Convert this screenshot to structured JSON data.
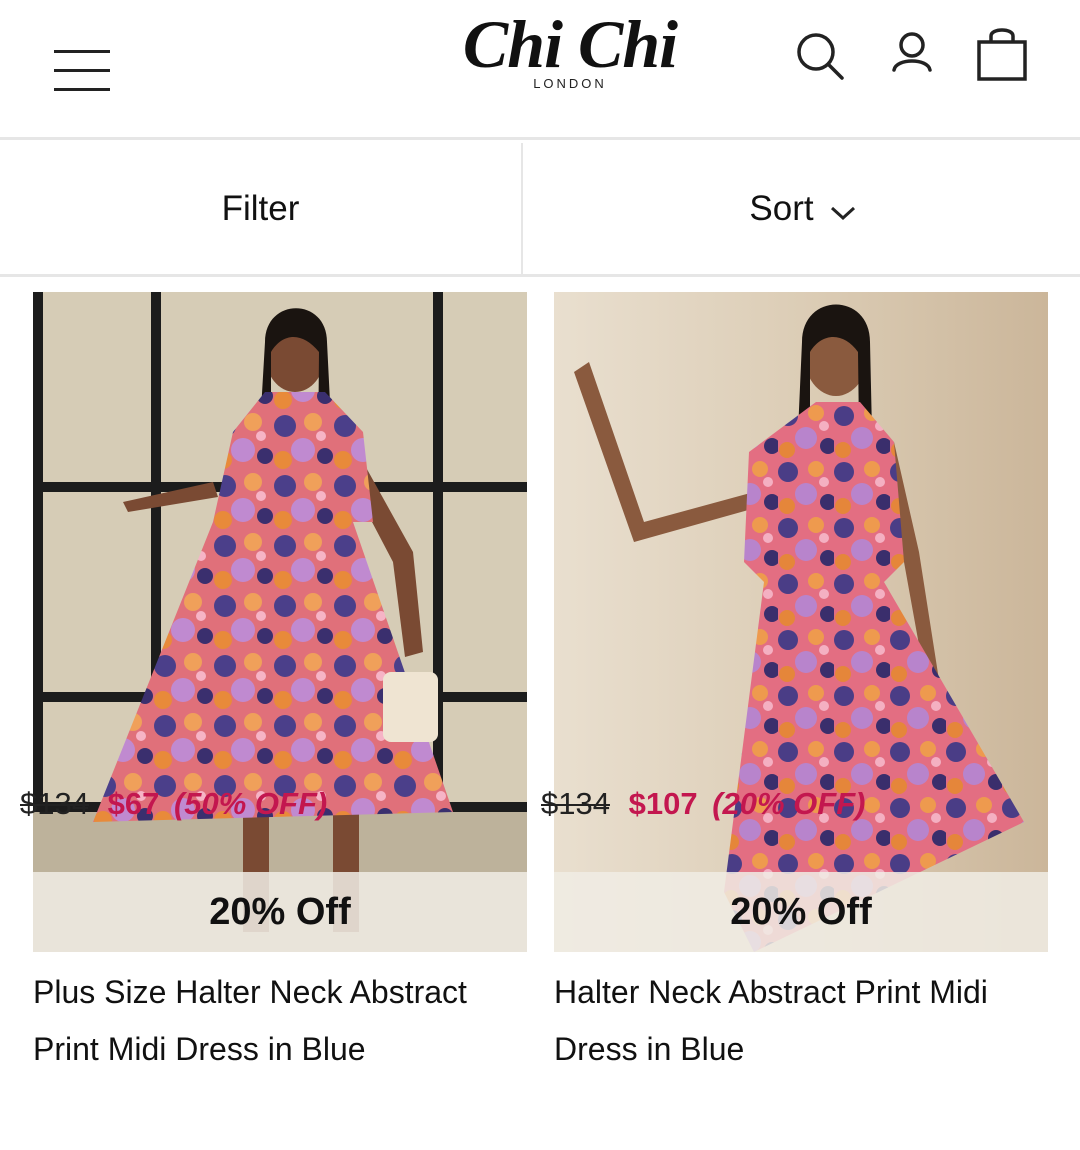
{
  "header": {
    "logo_main": "Chi Chi",
    "logo_sub": "LONDON",
    "menu_icon": "hamburger-menu-icon",
    "search_icon": "search-icon",
    "account_icon": "account-icon",
    "bag_icon": "shopping-bag-icon"
  },
  "toolbar": {
    "filter_label": "Filter",
    "sort_label": "Sort",
    "sort_icon": "chevron-down-icon"
  },
  "colors": {
    "sale": "#c3174f",
    "divider": "#e6e6e6",
    "badge_bg": "#f0ece4"
  },
  "products": [
    {
      "image_alt": "Model in floral halter neck midi dress against window",
      "badge": "20% Off",
      "title": "Plus Size Halter Neck Abstract Print Midi Dress in Blue",
      "price_original": "$134",
      "price_sale": "$67",
      "price_discount": "(50% OFF)"
    },
    {
      "image_alt": "Model in floral halter neck midi dress leaning on wall",
      "badge": "20% Off",
      "title": "Halter Neck Abstract Print Midi Dress in Blue",
      "price_original": "$134",
      "price_sale": "$107",
      "price_discount": "(20% OFF)"
    }
  ]
}
